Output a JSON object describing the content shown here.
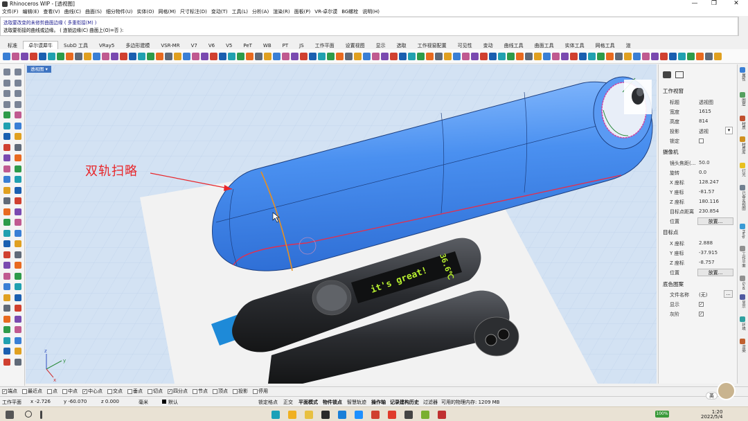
{
  "titlebar": {
    "title": "Rhinoceros WIP - [透视图]",
    "minimize": "—",
    "maximize": "❐",
    "close": "✕"
  },
  "menu": [
    "文件(F)",
    "编辑(E)",
    "查看(V)",
    "曲线(C)",
    "曲面(S)",
    "细分物件(U)",
    "实体(O)",
    "网格(M)",
    "尺寸标注(D)",
    "变动(T)",
    "工具(L)",
    "分析(A)",
    "渲染(R)",
    "面板(P)",
    "VR-卓尔谟",
    "BG螺栓",
    "说明(H)"
  ],
  "command": {
    "line1": "选取要改变的未修剪曲面边缘 ( 多重衔接(M) )",
    "line2": "选取要衔接的曲线或边缘。 ( 连锁边缘(C)  曲面上(O)=否 ):"
  },
  "tabs": [
    "标准",
    "卓尔谟犀牛",
    "SubD 工具",
    "VRay5",
    "多边形建模",
    "VSR-MR",
    "V7",
    "V6",
    "V5",
    "PeT",
    "WB",
    "PT",
    "JS",
    "工作平面",
    "设置视图",
    "显示",
    "选取",
    "工作视窗配置",
    "可见性",
    "变动",
    "曲线工具",
    "曲面工具",
    "实体工具",
    "网格工具",
    "渲"
  ],
  "active_tab_index": 1,
  "viewport": {
    "tab_label": "透视图",
    "annotation": "双轨扫略",
    "screen_text": "it's great!",
    "temp_text": "36.6℃"
  },
  "properties": {
    "section_viewport": "工作视窗",
    "title_label": "标题",
    "title_value": "透视图",
    "width_label": "宽度",
    "width_value": "1615",
    "height_label": "高度",
    "height_value": "814",
    "projection_label": "投影",
    "projection_value": "透视",
    "lock_label": "锁定",
    "section_camera": "摄像机",
    "lens_label": "镜头焦距(...",
    "lens_value": "50.0",
    "rotation_label": "旋转",
    "rotation_value": "0.0",
    "cx_label": "X 座标",
    "cx_value": "128.247",
    "cy_label": "Y 座标",
    "cy_value": "-81.57",
    "cz_label": "Z 座标",
    "cz_value": "180.116",
    "dist_label": "目标点距离",
    "dist_value": "230.854",
    "pos_label": "位置",
    "place_btn": "放置...",
    "section_target": "目标点",
    "tx_label": "X 座标",
    "tx_value": "2.888",
    "ty_label": "Y 座标",
    "ty_value": "-37.915",
    "tz_label": "Z 座标",
    "tz_value": "-8.757",
    "tpos_label": "位置",
    "tplace_btn": "放置...",
    "section_bg": "底色图案",
    "filename_label": "文件名称",
    "filename_value": "(无)",
    "browse": "...",
    "show_label": "显示",
    "gray_label": "灰阶"
  },
  "right_strip": [
    "属性",
    "图层",
    "材质",
    "材质库",
    "灯光",
    "已命名视图",
    "Help",
    "工作平面",
    "Grid",
    "显示",
    "环境",
    "渲染"
  ],
  "osnap": [
    {
      "label": "端点",
      "checked": true
    },
    {
      "label": "最近点",
      "checked": false
    },
    {
      "label": "点",
      "checked": false
    },
    {
      "label": "中点",
      "checked": false
    },
    {
      "label": "中心点",
      "checked": true
    },
    {
      "label": "交点",
      "checked": false
    },
    {
      "label": "垂点",
      "checked": false
    },
    {
      "label": "切点",
      "checked": false
    },
    {
      "label": "四分点",
      "checked": true
    },
    {
      "label": "节点",
      "checked": false
    },
    {
      "label": "顶点",
      "checked": false
    },
    {
      "label": "投影",
      "checked": false
    },
    {
      "label": "停用",
      "checked": false
    }
  ],
  "status": {
    "cplane": "工作平面",
    "x": "x -2.726",
    "y": "y -60.070",
    "z": "z 0.000",
    "unit": "毫米",
    "layer": "默认",
    "lock_grid": "锁定格点",
    "ortho": "正交",
    "planar": "平面模式",
    "osnap": "物件锁点",
    "smart": "智慧轨迹",
    "gumball": "操作轴",
    "history": "记录建构历史",
    "filter": "过滤器",
    "memory": "可用的物理内存: 1209 MB"
  },
  "taskbar": {
    "time": "1:20",
    "date": "2022/5/4",
    "battery": "100%",
    "ime": "英"
  },
  "colors": {
    "accent": "#3e74c2",
    "surface": "#4a90f0",
    "annot": "#e8262a"
  }
}
